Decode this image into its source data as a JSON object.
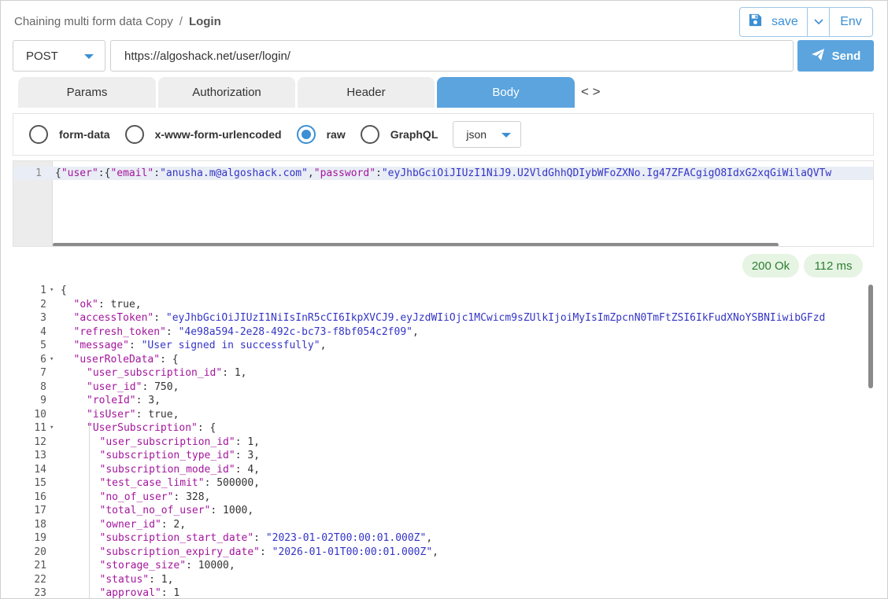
{
  "breadcrumb": {
    "collection": "Chaining multi form data Copy",
    "separator": "/",
    "current": "Login"
  },
  "toolbar": {
    "save_label": "save",
    "env_label": "Env"
  },
  "request": {
    "method": "POST",
    "url": "https://algoshack.net/user/login/",
    "send_label": "Send"
  },
  "tabs": [
    {
      "label": "Params"
    },
    {
      "label": "Authorization"
    },
    {
      "label": "Header"
    },
    {
      "label": "Body"
    }
  ],
  "code_toggle": "< >",
  "body_types": [
    {
      "label": "form-data"
    },
    {
      "label": "x-www-form-urlencoded"
    },
    {
      "label": "raw"
    },
    {
      "label": "GraphQL"
    }
  ],
  "body_format": "json",
  "request_body": {
    "line_number": "1",
    "tokens": [
      {
        "t": "{",
        "c": "p"
      },
      {
        "t": "\"user\"",
        "c": "k"
      },
      {
        "t": ":{",
        "c": "p"
      },
      {
        "t": "\"email\"",
        "c": "k"
      },
      {
        "t": ":",
        "c": "p"
      },
      {
        "t": "\"anusha.m@algoshack.com\"",
        "c": "s"
      },
      {
        "t": ",",
        "c": "p"
      },
      {
        "t": "\"password\"",
        "c": "k"
      },
      {
        "t": ":",
        "c": "p"
      },
      {
        "t": "\"eyJhbGciOiJIUzI1NiJ9.U2VldGhhQDIybWFoZXNo.Ig47ZFACgigO8IdxG2xqGiWilaQVTw",
        "c": "s"
      }
    ]
  },
  "response": {
    "status": "200 Ok",
    "time": "112 ms",
    "lines": [
      {
        "n": "1",
        "fold": "▾",
        "indent": 0,
        "tokens": [
          {
            "t": "{",
            "c": "p"
          }
        ]
      },
      {
        "n": "2",
        "indent": 1,
        "tokens": [
          {
            "t": "\"ok\"",
            "c": "k"
          },
          {
            "t": ": true,",
            "c": "n"
          }
        ]
      },
      {
        "n": "3",
        "indent": 1,
        "tokens": [
          {
            "t": "\"accessToken\"",
            "c": "k"
          },
          {
            "t": ": ",
            "c": "p"
          },
          {
            "t": "\"eyJhbGciOiJIUzI1NiIsInR5cCI6IkpXVCJ9.eyJzdWIiOjc1MCwicm9sZUlkIjoiMyIsImZpcnN0TmFtZSI6IkFudXNoYSBNIiwibGFzd",
            "c": "s"
          }
        ]
      },
      {
        "n": "4",
        "indent": 1,
        "tokens": [
          {
            "t": "\"refresh_token\"",
            "c": "k"
          },
          {
            "t": ": ",
            "c": "p"
          },
          {
            "t": "\"4e98a594-2e28-492c-bc73-f8bf054c2f09\"",
            "c": "s"
          },
          {
            "t": ",",
            "c": "p"
          }
        ]
      },
      {
        "n": "5",
        "indent": 1,
        "tokens": [
          {
            "t": "\"message\"",
            "c": "k"
          },
          {
            "t": ": ",
            "c": "p"
          },
          {
            "t": "\"User signed in successfully\"",
            "c": "s"
          },
          {
            "t": ",",
            "c": "p"
          }
        ]
      },
      {
        "n": "6",
        "fold": "▾",
        "indent": 1,
        "tokens": [
          {
            "t": "\"userRoleData\"",
            "c": "k"
          },
          {
            "t": ": {",
            "c": "p"
          }
        ]
      },
      {
        "n": "7",
        "indent": 2,
        "tokens": [
          {
            "t": "\"user_subscription_id\"",
            "c": "k"
          },
          {
            "t": ": 1,",
            "c": "n"
          }
        ]
      },
      {
        "n": "8",
        "indent": 2,
        "tokens": [
          {
            "t": "\"user_id\"",
            "c": "k"
          },
          {
            "t": ": 750,",
            "c": "n"
          }
        ]
      },
      {
        "n": "9",
        "indent": 2,
        "tokens": [
          {
            "t": "\"roleId\"",
            "c": "k"
          },
          {
            "t": ": 3,",
            "c": "n"
          }
        ]
      },
      {
        "n": "10",
        "indent": 2,
        "tokens": [
          {
            "t": "\"isUser\"",
            "c": "k"
          },
          {
            "t": ": true,",
            "c": "n"
          }
        ]
      },
      {
        "n": "11",
        "fold": "▾",
        "indent": 2,
        "tokens": [
          {
            "t": "\"UserSubscription\"",
            "c": "k"
          },
          {
            "t": ": {",
            "c": "p"
          }
        ]
      },
      {
        "n": "12",
        "indent": 3,
        "tokens": [
          {
            "t": "\"user_subscription_id\"",
            "c": "k"
          },
          {
            "t": ": 1,",
            "c": "n"
          }
        ]
      },
      {
        "n": "13",
        "indent": 3,
        "tokens": [
          {
            "t": "\"subscription_type_id\"",
            "c": "k"
          },
          {
            "t": ": 3,",
            "c": "n"
          }
        ]
      },
      {
        "n": "14",
        "indent": 3,
        "tokens": [
          {
            "t": "\"subscription_mode_id\"",
            "c": "k"
          },
          {
            "t": ": 4,",
            "c": "n"
          }
        ]
      },
      {
        "n": "15",
        "indent": 3,
        "tokens": [
          {
            "t": "\"test_case_limit\"",
            "c": "k"
          },
          {
            "t": ": 500000,",
            "c": "n"
          }
        ]
      },
      {
        "n": "16",
        "indent": 3,
        "tokens": [
          {
            "t": "\"no_of_user\"",
            "c": "k"
          },
          {
            "t": ": 328,",
            "c": "n"
          }
        ]
      },
      {
        "n": "17",
        "indent": 3,
        "tokens": [
          {
            "t": "\"total_no_of_user\"",
            "c": "k"
          },
          {
            "t": ": 1000,",
            "c": "n"
          }
        ]
      },
      {
        "n": "18",
        "indent": 3,
        "tokens": [
          {
            "t": "\"owner_id\"",
            "c": "k"
          },
          {
            "t": ": 2,",
            "c": "n"
          }
        ]
      },
      {
        "n": "19",
        "indent": 3,
        "tokens": [
          {
            "t": "\"subscription_start_date\"",
            "c": "k"
          },
          {
            "t": ": ",
            "c": "p"
          },
          {
            "t": "\"2023-01-02T00:00:01.000Z\"",
            "c": "s"
          },
          {
            "t": ",",
            "c": "p"
          }
        ]
      },
      {
        "n": "20",
        "indent": 3,
        "tokens": [
          {
            "t": "\"subscription_expiry_date\"",
            "c": "k"
          },
          {
            "t": ": ",
            "c": "p"
          },
          {
            "t": "\"2026-01-01T00:00:01.000Z\"",
            "c": "s"
          },
          {
            "t": ",",
            "c": "p"
          }
        ]
      },
      {
        "n": "21",
        "indent": 3,
        "tokens": [
          {
            "t": "\"storage_size\"",
            "c": "k"
          },
          {
            "t": ": 10000,",
            "c": "n"
          }
        ]
      },
      {
        "n": "22",
        "indent": 3,
        "tokens": [
          {
            "t": "\"status\"",
            "c": "k"
          },
          {
            "t": ": 1,",
            "c": "n"
          }
        ]
      },
      {
        "n": "23",
        "indent": 3,
        "tokens": [
          {
            "t": "\"approval\"",
            "c": "k"
          },
          {
            "t": ": 1",
            "c": "n"
          }
        ]
      }
    ]
  },
  "colors": {
    "accent": "#5ba4de",
    "json_key": "#a3159d",
    "json_string": "#3434c7",
    "status_bg": "#e6f4e3",
    "status_text": "#2e7d32"
  },
  "icons": {
    "save": "floppy-disk-icon",
    "chevron": "chevron-down-icon",
    "send": "paper-plane-icon",
    "code": "code-brackets-icon"
  }
}
